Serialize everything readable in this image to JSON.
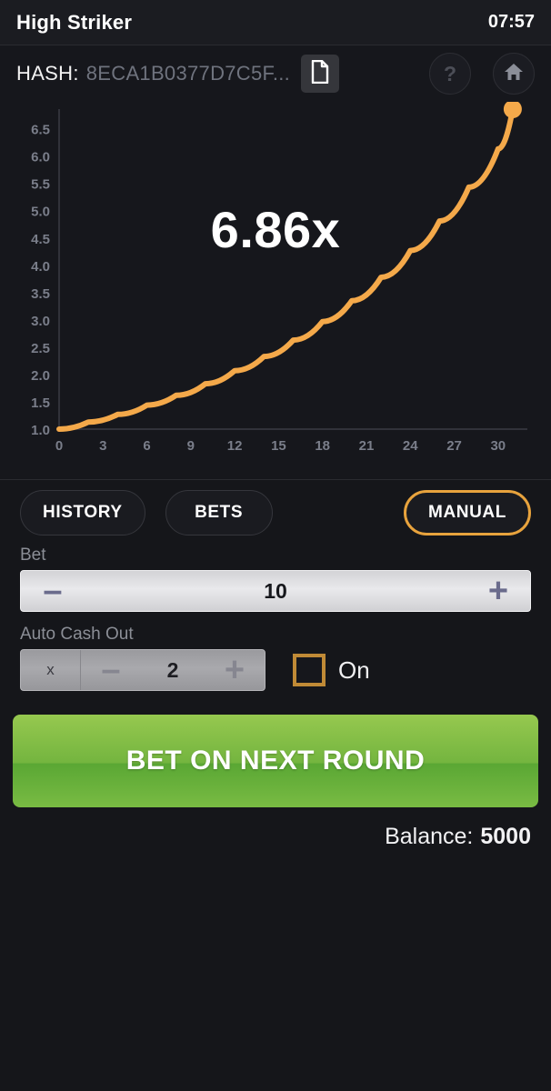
{
  "titlebar": {
    "title": "High Striker",
    "clock": "07:57"
  },
  "hashbar": {
    "label": "HASH:",
    "value": "8ECA1B0377D7C5F...",
    "copy_icon": "document-icon",
    "help_icon": "question-mark-icon",
    "help_glyph": "?",
    "home_icon": "home-icon"
  },
  "chart": {
    "multiplier": "6.86x"
  },
  "chart_data": {
    "type": "line",
    "title": "",
    "xlabel": "",
    "ylabel": "",
    "xlim": [
      0,
      32
    ],
    "ylim": [
      1.0,
      6.86
    ],
    "grid": false,
    "legend": "none",
    "line_color": "#f4a94a",
    "endpoint_marker": true,
    "xticks": [
      0,
      3,
      6,
      9,
      12,
      15,
      18,
      21,
      24,
      27,
      30
    ],
    "yticks": [
      1.0,
      1.5,
      2.0,
      2.5,
      3.0,
      3.5,
      4.0,
      4.5,
      5.0,
      5.5,
      6.0,
      6.5
    ],
    "ytick_labels": [
      "1.0",
      "1.5",
      "2.0",
      "2.5",
      "3.0",
      "3.5",
      "4.0",
      "4.5",
      "5.0",
      "5.5",
      "6.0",
      "6.5"
    ],
    "xtick_labels": [
      "0",
      "3",
      "6",
      "9",
      "12",
      "15",
      "18",
      "21",
      "24",
      "27",
      "30"
    ],
    "x": [
      0,
      2,
      4,
      6,
      8,
      10,
      12,
      14,
      16,
      18,
      20,
      22,
      24,
      26,
      28,
      30,
      31
    ],
    "y": [
      1.0,
      1.13,
      1.27,
      1.44,
      1.62,
      1.83,
      2.07,
      2.33,
      2.63,
      2.97,
      3.35,
      3.78,
      4.27,
      4.81,
      5.43,
      6.13,
      6.86
    ],
    "series": [
      {
        "name": "multiplier",
        "values": [
          1.0,
          1.13,
          1.27,
          1.44,
          1.62,
          1.83,
          2.07,
          2.33,
          2.63,
          2.97,
          3.35,
          3.78,
          4.27,
          4.81,
          5.43,
          6.13,
          6.86
        ]
      }
    ]
  },
  "tabs": {
    "history": "HISTORY",
    "bets": "BETS",
    "mode": "MANUAL"
  },
  "bet": {
    "label": "Bet",
    "value": "10",
    "minus": "–",
    "plus": "+"
  },
  "auto_cashout": {
    "label": "Auto Cash Out",
    "prefix": "x",
    "value": "2",
    "minus": "–",
    "plus": "+",
    "toggle_label": "On",
    "toggle_checked": false
  },
  "cta": {
    "label": "BET ON NEXT ROUND"
  },
  "balance": {
    "label": "Balance:",
    "amount": "5000"
  },
  "colors": {
    "accent_orange": "#e8a33d",
    "curve_orange": "#f4a94a",
    "cta_green": "#74b53f",
    "background": "#15161a",
    "panel": "#16171c"
  }
}
